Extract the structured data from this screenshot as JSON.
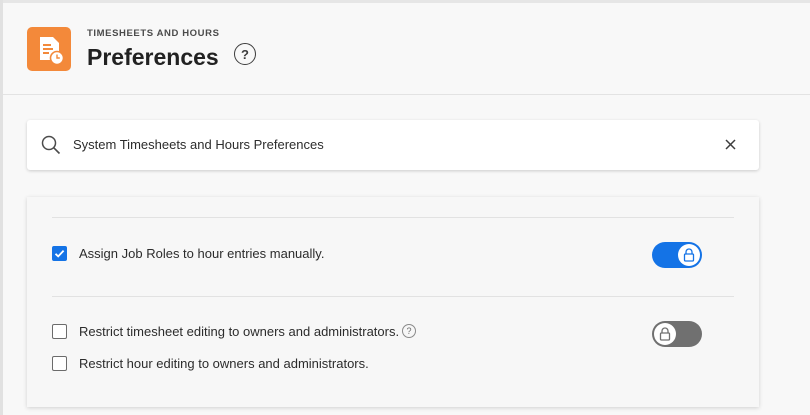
{
  "header": {
    "overline": "TIMESHEETS AND HOURS",
    "title": "Preferences",
    "help_glyph": "?",
    "app_icon": "timesheet-clock-icon",
    "accent_color": "#f3893a"
  },
  "search": {
    "value": "System Timesheets and Hours Preferences",
    "search_icon": "search-icon",
    "clear_icon": "close-icon"
  },
  "options": [
    {
      "label": "Assign Job Roles to hour entries manually.",
      "checked": true
    },
    {
      "label": "Restrict timesheet editing to owners and administrators.",
      "checked": false,
      "help_glyph": "?"
    },
    {
      "label": "Restrict hour editing to owners and administrators.",
      "checked": false
    }
  ],
  "toggles": [
    {
      "state": "on",
      "icon": "lock-icon",
      "color": "#1473e6"
    },
    {
      "state": "off",
      "icon": "lock-icon",
      "color": "#707070"
    }
  ]
}
